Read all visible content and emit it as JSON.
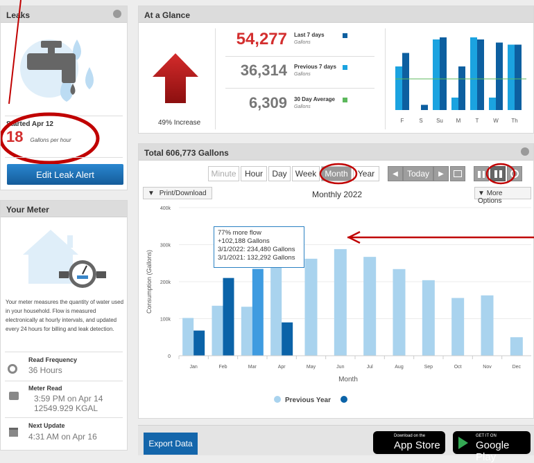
{
  "leaks": {
    "title": "Leaks",
    "started": "Started Apr 12",
    "rate_value": "18",
    "rate_unit": "Gallons per hour",
    "edit_button": "Edit Leak Alert"
  },
  "meter": {
    "title": "Your Meter",
    "description": "Your meter measures the quantity of water used in your household. Flow is measured electronically at hourly intervals, and updated every 24 hours for billing and leak detection.",
    "read_frequency_label": "Read Frequency",
    "read_frequency_value": "36 Hours",
    "meter_read_label": "Meter Read",
    "meter_read_time": "3:59 PM on Apr 14",
    "meter_read_value": "12549.929 KGAL",
    "next_update_label": "Next Update",
    "next_update_value": "4:31 AM on Apr 16"
  },
  "glance": {
    "title": "At a Glance",
    "increase": "49% Increase",
    "stats": [
      {
        "value": "54,277",
        "label": "Last 7 days",
        "unit": "Gallons",
        "color": "#d32f2f",
        "swatch": "#0d5fa0"
      },
      {
        "value": "36,314",
        "label": "Previous 7 days",
        "unit": "Gallons",
        "color": "#777777",
        "swatch": "#1ba3e0"
      },
      {
        "value": "6,309",
        "label": "30 Day Average",
        "unit": "Gallons",
        "color": "#777777",
        "swatch": "#5cb85c"
      }
    ],
    "mini_days": [
      "F",
      "S",
      "Su",
      "M",
      "T",
      "W",
      "Th"
    ],
    "mini_current": [
      55,
      5,
      70,
      42,
      68,
      65,
      63
    ],
    "mini_previous": [
      42,
      0,
      68,
      12,
      70,
      12,
      63
    ],
    "mini_average": 30
  },
  "total": {
    "title": "Total 606,773 Gallons",
    "tabs": [
      "Minute",
      "Hour",
      "Day",
      "Week",
      "Month",
      "Year"
    ],
    "active_tab": "Month",
    "today": "Today",
    "print": "Print/Download",
    "chart_title": "Monthly 2022",
    "more_options": "More Options",
    "export": "Export Data",
    "app_store_small": "Download on the",
    "app_store_big": "App Store",
    "google_small": "GET IT ON",
    "google_big": "Google Play"
  },
  "tooltip": {
    "line1": "77% more flow",
    "line2": "+102,188 Gallons",
    "line3": "3/1/2022: 234,480 Gallons",
    "line4": "3/1/2021: 132,292 Gallons"
  },
  "chart_data": {
    "type": "bar",
    "categories": [
      "Jan",
      "Feb",
      "Mar",
      "Apr",
      "May",
      "Jun",
      "Jul",
      "Aug",
      "Sep",
      "Oct",
      "Nov",
      "Dec"
    ],
    "series": [
      {
        "name": "Previous Year",
        "color": "#a9d3ee",
        "values": [
          102000,
          135000,
          132292,
          245000,
          262000,
          288000,
          267000,
          234000,
          204000,
          156000,
          163000,
          50000
        ]
      },
      {
        "name": "",
        "color": "#0b63a8",
        "values": [
          68000,
          210000,
          234480,
          90000,
          null,
          null,
          null,
          null,
          null,
          null,
          null,
          null
        ]
      }
    ],
    "highlight_color": "#3f9be0",
    "xlabel": "Month",
    "ylabel": "Consumption (Gallons)",
    "ylim": [
      0,
      400000
    ],
    "yticks": [
      "0",
      "100k",
      "200k",
      "300k",
      "400k"
    ],
    "legend_position": "bottom"
  }
}
